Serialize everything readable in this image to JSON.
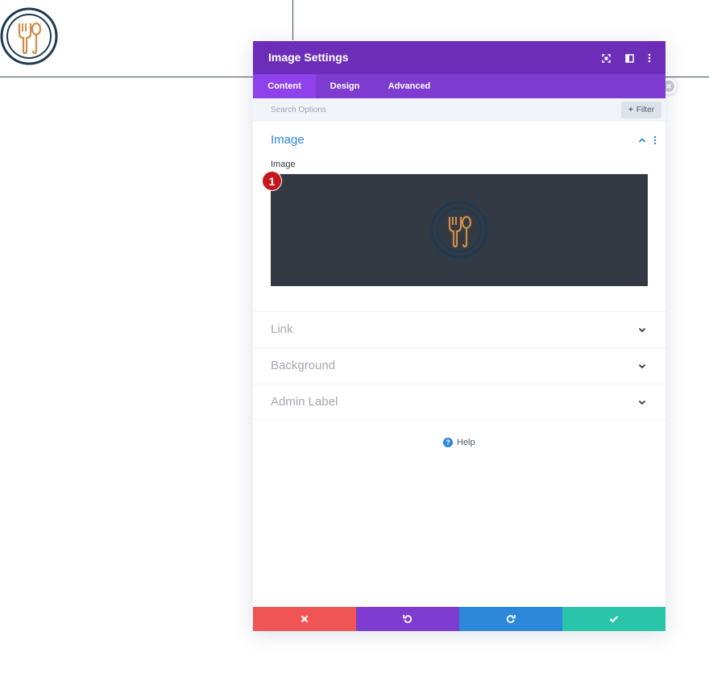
{
  "modal": {
    "title": "Image Settings",
    "icons": [
      "focus-icon",
      "split-view-icon",
      "more-vertical-icon"
    ]
  },
  "tabs": [
    {
      "label": "Content",
      "active": true
    },
    {
      "label": "Design",
      "active": false
    },
    {
      "label": "Advanced",
      "active": false
    }
  ],
  "search": {
    "placeholder": "Search Options",
    "filter_label": "Filter"
  },
  "image_section": {
    "title": "Image",
    "field_label": "Image",
    "badge": "1"
  },
  "toggles": [
    {
      "label": "Link"
    },
    {
      "label": "Background"
    },
    {
      "label": "Admin Label"
    }
  ],
  "help": {
    "label": "Help"
  },
  "footer": {
    "buttons": [
      {
        "name": "discard-button",
        "color": "#ef5555"
      },
      {
        "name": "undo-button",
        "color": "#7e3bd0"
      },
      {
        "name": "redo-button",
        "color": "#2b87da"
      },
      {
        "name": "save-button",
        "color": "#29c4a9"
      }
    ]
  },
  "colors": {
    "header": "#6c2eb9",
    "tabs": "#7e3bd0",
    "accent": "#2b87da",
    "logo_orange": "#d08d48",
    "logo_navy": "#1e3a55"
  }
}
